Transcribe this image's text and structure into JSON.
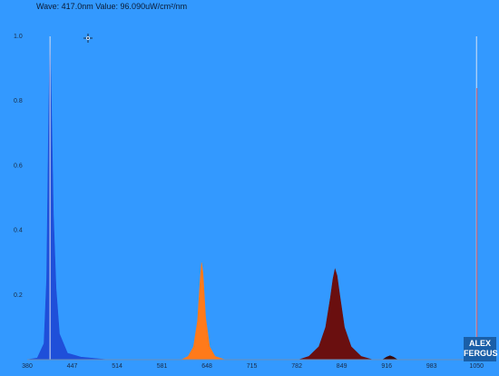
{
  "readout": {
    "text": "Wave: 417.0nm Value: 96.090uW/cm²/nm"
  },
  "colors": {
    "background": "#3399ff",
    "axis": "#6b8fb8",
    "violet_peak": "#1f4fd9",
    "orange_peak": "#ff7a1a",
    "red_peak": "#6a0f0f"
  },
  "chart_data": {
    "type": "area",
    "title": "",
    "xlabel": "",
    "ylabel": "",
    "xlim": [
      380,
      1070
    ],
    "ylim": [
      0,
      1.0
    ],
    "x_ticks": [
      "380",
      "447",
      "514",
      "581",
      "648",
      "715",
      "782",
      "849",
      "916",
      "983",
      "1050"
    ],
    "y_ticks": [
      "0.2",
      "0.4",
      "0.6",
      "0.8",
      "1.0"
    ],
    "grid": false,
    "cursor_wavelength": 417.0,
    "cursor_value": 96.09,
    "series": [
      {
        "peak_nm": 414,
        "peak_value": 1.0,
        "color": "#1f4fd9",
        "x": [
          380,
          395,
          405,
          409,
          412,
          414,
          416,
          419,
          423,
          428,
          440,
          460,
          500
        ],
        "y": [
          0,
          0.005,
          0.05,
          0.25,
          0.75,
          1.0,
          0.8,
          0.45,
          0.22,
          0.08,
          0.02,
          0.008,
          0
        ]
      },
      {
        "peak_nm": 640,
        "peak_value": 0.3,
        "color": "#ff7a1a",
        "x": [
          610,
          620,
          628,
          634,
          638,
          640,
          642,
          646,
          652,
          660,
          675
        ],
        "y": [
          0,
          0.01,
          0.04,
          0.12,
          0.25,
          0.3,
          0.27,
          0.13,
          0.04,
          0.01,
          0
        ]
      },
      {
        "peak_nm": 839,
        "peak_value": 0.28,
        "color": "#6a0f0f",
        "x": [
          785,
          800,
          815,
          825,
          832,
          836,
          839,
          842,
          846,
          853,
          863,
          878,
          895
        ],
        "y": [
          0,
          0.01,
          0.04,
          0.1,
          0.19,
          0.25,
          0.28,
          0.26,
          0.2,
          0.1,
          0.04,
          0.01,
          0
        ]
      },
      {
        "peak_nm": 921,
        "peak_value": 0.01,
        "color": "#3a0a0a",
        "x": [
          910,
          916,
          921,
          926,
          932
        ],
        "y": [
          0,
          0.008,
          0.012,
          0.008,
          0
        ]
      }
    ],
    "markers": [
      {
        "x": 414,
        "y_top": 1.0,
        "color": "#d8e4f2"
      },
      {
        "x": 1050,
        "y_top": 1.0,
        "color": "#d8e4f2"
      }
    ]
  },
  "watermark": {
    "line1": "ALEX",
    "line2": "FERGUS"
  }
}
